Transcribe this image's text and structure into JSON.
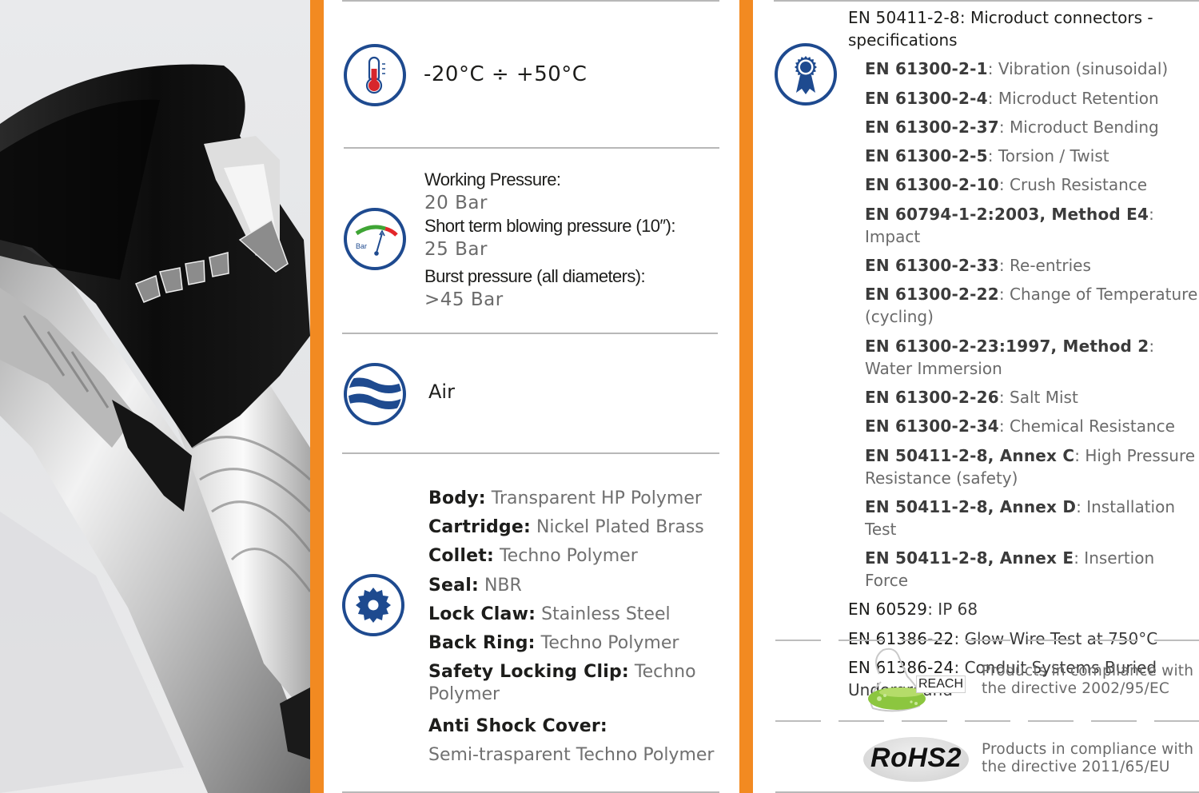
{
  "colors": {
    "accent_orange": "#f28a21",
    "icon_blue": "#1e4a8f",
    "thermo_red": "#d7262c",
    "gauge_green": "#3fa535",
    "gauge_red": "#e3262a",
    "reach_green": "#8cc63f",
    "label_dark": "#1d1d1b",
    "value_gray": "#6b6b6b"
  },
  "product_image": {
    "alt": "Cross-section of microduct push-fit connector"
  },
  "icons": {
    "temperature": "thermometer-icon",
    "pressure": "pressure-gauge-icon",
    "fluid": "air-waves-icon",
    "materials": "gear-icon",
    "standards": "award-ribbon-icon"
  },
  "temperature": {
    "range": "-20°C ÷ +50°C"
  },
  "pressure": {
    "gauge_label": "Bar",
    "items": [
      {
        "label": "Working Pressure:",
        "value": "20 Bar"
      },
      {
        "label": "Short term blowing pressure (10″):",
        "value": "25 Bar"
      },
      {
        "label": "Burst pressure (all diameters):",
        "value": ">45 Bar"
      }
    ]
  },
  "fluid": {
    "medium": "Air"
  },
  "materials": [
    {
      "component": "Body:",
      "material": "Transparent HP Polymer"
    },
    {
      "component": "Cartridge:",
      "material": "Nickel Plated Brass"
    },
    {
      "component": "Collet:",
      "material": "Techno Polymer"
    },
    {
      "component": "Seal:",
      "material": "NBR"
    },
    {
      "component": "Lock Claw:",
      "material": "Stainless Steel"
    },
    {
      "component": "Back Ring:",
      "material": "Techno Polymer"
    },
    {
      "component": "Safety Locking Clip:",
      "material": "Techno Polymer"
    },
    {
      "component": "Anti Shock Cover:",
      "material": "Semi-trasparent Techno Polymer"
    }
  ],
  "standards": {
    "main": {
      "code": "EN 50411-2-8",
      "description": "Microduct connectors - specifications"
    },
    "sub": [
      {
        "code": "EN 61300-2-1",
        "description": "Vibration (sinusoidal)"
      },
      {
        "code": "EN 61300-2-4",
        "description": "Microduct Retention"
      },
      {
        "code": "EN 61300-2-37",
        "description": "Microduct Bending"
      },
      {
        "code": "EN 61300-2-5",
        "description": "Torsion / Twist"
      },
      {
        "code": "EN 61300-2-10",
        "description": "Crush Resistance"
      },
      {
        "code": "EN 60794-1-2:2003, Method E4",
        "description": "Impact"
      },
      {
        "code": "EN 61300-2-33",
        "description": "Re-entries"
      },
      {
        "code": "EN 61300-2-22",
        "description": "Change of Temperature (cycling)"
      },
      {
        "code": "EN 61300-2-23:1997, Method 2",
        "description": "Water Immersion"
      },
      {
        "code": "EN 61300-2-26",
        "description": "Salt Mist"
      },
      {
        "code": "EN 61300-2-34",
        "description": "Chemical Resistance"
      },
      {
        "code": "EN 50411-2-8, Annex C",
        "description": "High Pressure Resistance (safety)"
      },
      {
        "code": "EN 50411-2-8, Annex D",
        "description": "Installation Test"
      },
      {
        "code": "EN 50411-2-8, Annex E",
        "description": "Insertion Force"
      }
    ],
    "other": [
      {
        "code": "EN 60529",
        "description": "IP 68"
      },
      {
        "code": "EN 61386-22",
        "description": "Glow Wire Test at 750°C"
      },
      {
        "code": "EN 61386-24",
        "description": "Conduit Systems Buried Underground"
      }
    ]
  },
  "compliance": [
    {
      "badge": "REACH",
      "line1": "Products in compliance with",
      "line2": "the directive 2002/95/EC"
    },
    {
      "badge": "RoHS2",
      "line1": "Products in compliance with",
      "line2": "the directive 2011/65/EU"
    }
  ]
}
